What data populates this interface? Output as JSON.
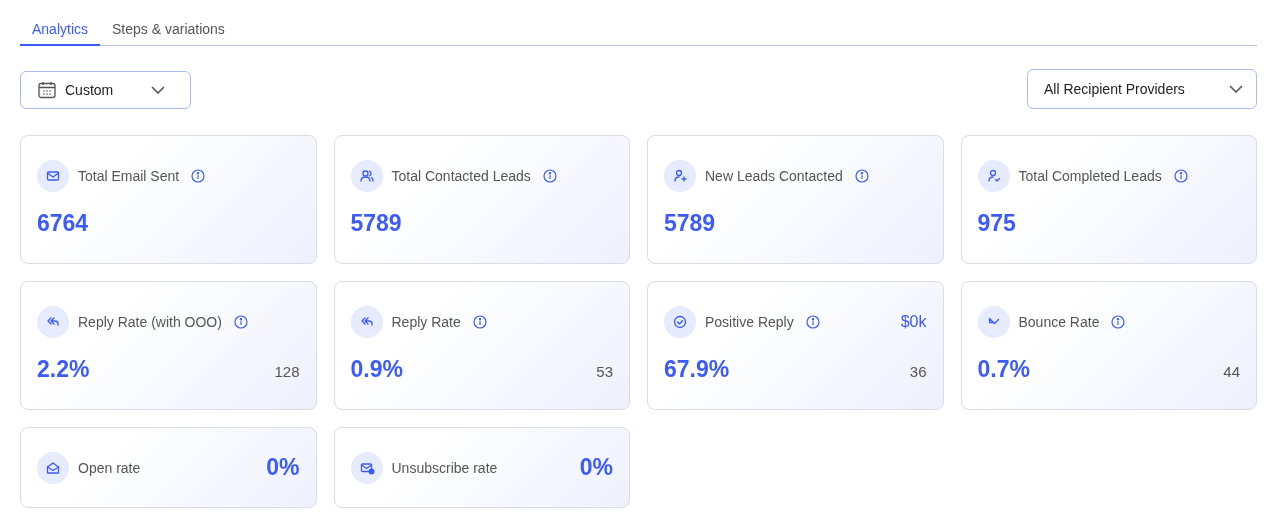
{
  "tabs": [
    {
      "label": "Analytics",
      "selected": true
    },
    {
      "label": "Steps & variations",
      "selected": false
    }
  ],
  "date_filter": {
    "value": "Custom"
  },
  "provider_filter": {
    "value": "All Recipient Providers"
  },
  "cards": [
    {
      "kind": "stat",
      "label": "Total Email Sent",
      "info": true,
      "value": "6764"
    },
    {
      "kind": "stat",
      "label": "Total Contacted Leads",
      "info": true,
      "value": "5789"
    },
    {
      "kind": "stat",
      "label": "New Leads Contacted",
      "info": true,
      "value": "5789"
    },
    {
      "kind": "stat",
      "label": "Total Completed Leads",
      "info": true,
      "value": "975"
    },
    {
      "kind": "rate",
      "label": "Reply Rate (with OOO)",
      "info": true,
      "value": "2.2%",
      "count": "128"
    },
    {
      "kind": "rate",
      "label": "Reply Rate",
      "info": true,
      "value": "0.9%",
      "count": "53"
    },
    {
      "kind": "rate",
      "label": "Positive Reply",
      "info": true,
      "value": "67.9%",
      "count": "36",
      "extra": "$0k"
    },
    {
      "kind": "rate",
      "label": "Bounce Rate",
      "info": true,
      "value": "0.7%",
      "count": "44"
    },
    {
      "kind": "compact",
      "label": "Open rate",
      "info": false,
      "value": "0%"
    },
    {
      "kind": "compact",
      "label": "Unsubscribe rate",
      "info": false,
      "value": "0%"
    }
  ]
}
